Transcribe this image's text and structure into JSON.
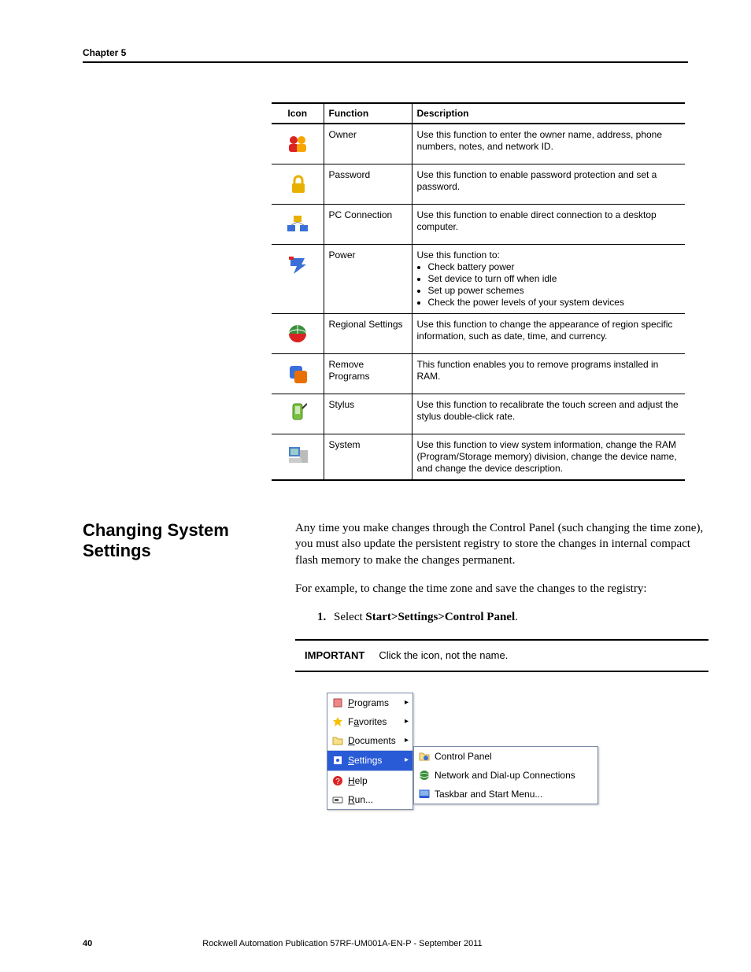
{
  "header": {
    "chapter": "Chapter 5"
  },
  "table": {
    "columns": [
      "Icon",
      "Function",
      "Description"
    ],
    "rows": [
      {
        "icon": "owner-icon",
        "function": "Owner",
        "description": "Use this function to enter the owner name, address, phone numbers, notes, and network ID."
      },
      {
        "icon": "password-icon",
        "function": "Password",
        "description": "Use this function to enable password protection and set a password."
      },
      {
        "icon": "pc-connection-icon",
        "function": "PC Connection",
        "description": "Use this function to enable direct connection to a desktop computer."
      },
      {
        "icon": "power-icon",
        "function": "Power",
        "description_intro": "Use this function to:",
        "description_list": [
          "Check battery power",
          "Set device to turn off when idle",
          "Set up power schemes",
          "Check the power levels of your system devices"
        ]
      },
      {
        "icon": "regional-settings-icon",
        "function": "Regional Settings",
        "description": "Use this function to change the appearance of region specific information, such as date, time, and currency."
      },
      {
        "icon": "remove-programs-icon",
        "function": "Remove Programs",
        "description": "This function enables you to remove programs installed in RAM."
      },
      {
        "icon": "stylus-icon",
        "function": "Stylus",
        "description": "Use this function to recalibrate the touch screen and adjust the stylus double-click rate."
      },
      {
        "icon": "system-icon",
        "function": "System",
        "description": "Use this function to view system information, change the RAM (Program/Storage memory) division, change the device name, and change the device description."
      }
    ]
  },
  "section": {
    "heading": "Changing System Settings",
    "para1": "Any time you make changes through the Control Panel (such changing the time zone), you must also update the persistent registry to store the changes in internal compact flash memory to make the changes permanent.",
    "para2": "For example, to change the time zone and save the changes to the registry:",
    "step_num": "1.",
    "step_text_a": "Select ",
    "step_text_b": "Start>Settings>Control Panel",
    "step_text_c": "."
  },
  "important": {
    "label": "IMPORTANT",
    "text": "Click the icon, not the name."
  },
  "startmenu": {
    "items": [
      {
        "label": "Programs",
        "underline": "P",
        "rest": "rograms",
        "arrow": true,
        "icon": "programs-icon"
      },
      {
        "label": "Favorites",
        "underline": "a",
        "prefix": "F",
        "rest": "vorites",
        "arrow": true,
        "icon": "favorites-icon"
      },
      {
        "label": "Documents",
        "underline": "D",
        "rest": "ocuments",
        "arrow": true,
        "icon": "documents-icon"
      },
      {
        "label": "Settings",
        "underline": "S",
        "rest": "ettings",
        "arrow": true,
        "icon": "settings-icon",
        "selected": true
      },
      {
        "label": "Help",
        "underline": "H",
        "rest": "elp",
        "icon": "help-icon"
      },
      {
        "label": "Run...",
        "underline": "R",
        "rest": "un...",
        "icon": "run-icon"
      }
    ],
    "submenu": [
      {
        "label": "Control Panel",
        "underline": "C",
        "rest": "ontrol Panel",
        "icon": "control-panel-icon"
      },
      {
        "label": "Network and Dial-up Connections",
        "underline": "N",
        "rest": "etwork and Dial-up Connections",
        "icon": "network-icon"
      },
      {
        "label": "Taskbar and Start Menu...",
        "underline": "T",
        "rest": "askbar and Start Menu...",
        "icon": "taskbar-icon"
      }
    ]
  },
  "footer": {
    "page": "40",
    "pub": "Rockwell Automation Publication 57RF-UM001A-EN-P - September 2011"
  }
}
